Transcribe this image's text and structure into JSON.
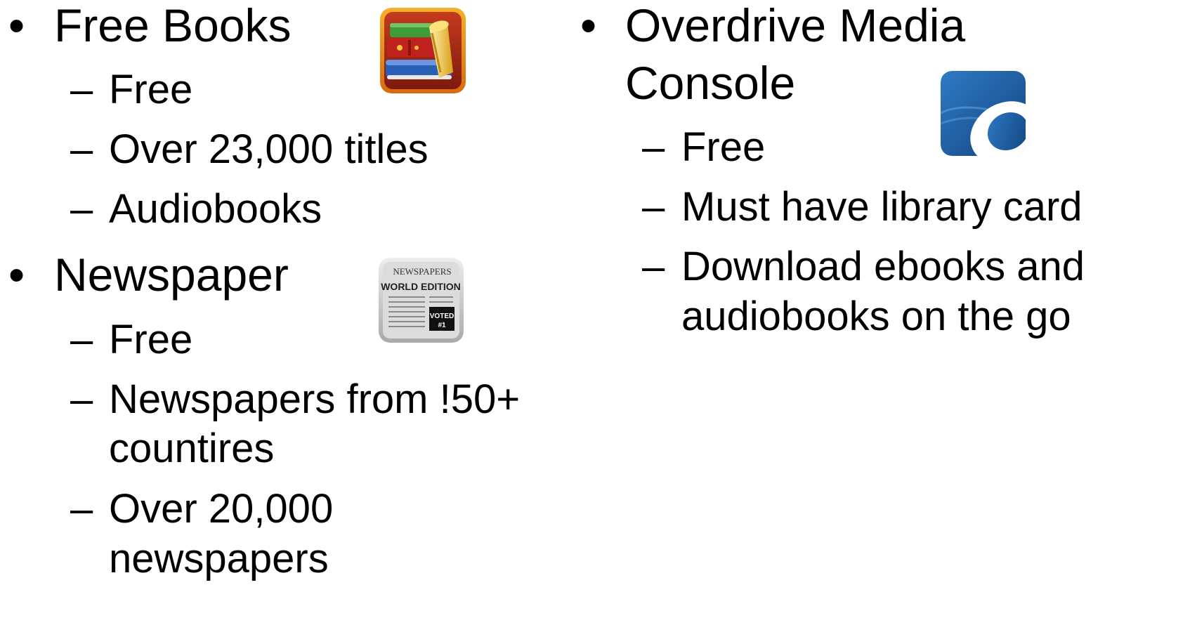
{
  "left_column": {
    "free_books": {
      "bullet": "•",
      "title": "Free Books",
      "items": [
        {
          "dash": "–",
          "text": "Free"
        },
        {
          "dash": "–",
          "text": "Over 23,000 titles"
        },
        {
          "dash": "–",
          "text": "Audiobooks"
        }
      ],
      "icon": "book-stack-icon"
    },
    "newspaper": {
      "bullet": "•",
      "title": "Newspaper",
      "items": [
        {
          "dash": "–",
          "text": "Free"
        },
        {
          "dash": "–",
          "line1": "Newspapers from !50+",
          "line2": "countires"
        },
        {
          "dash": "–",
          "line1": "Over 20,000",
          "line2": "newspapers"
        }
      ],
      "icon": "newspaper-icon",
      "icon_text_1": "NEWSPAPERS",
      "icon_text_2": "WORLD EDITION",
      "icon_text_3": "VOTED",
      "icon_text_4": "#1"
    }
  },
  "right_column": {
    "overdrive": {
      "bullet": "•",
      "title_line1": "Overdrive Media",
      "title_line2": "Console",
      "items": [
        {
          "dash": "–",
          "text": "Free"
        },
        {
          "dash": "–",
          "text": "Must have library card"
        },
        {
          "dash": "–",
          "line1": "Download ebooks and",
          "line2": "audiobooks on the go"
        }
      ],
      "icon": "overdrive-logo-icon"
    }
  },
  "colors": {
    "text": "#000000",
    "background": "#ffffff",
    "overdrive_blue": "#1f5d9f",
    "books_red": "#b3261e",
    "books_frame": "#f08a14",
    "newspaper_gray": "#b5b5b5"
  }
}
